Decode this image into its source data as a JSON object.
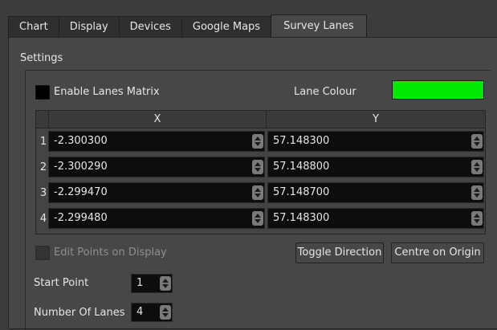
{
  "tabs": [
    "Chart",
    "Display",
    "Devices",
    "Google Maps",
    "Survey Lanes"
  ],
  "group_title": "Settings",
  "enable_lanes_label": "Enable Lanes Matrix",
  "lane_colour_label": "Lane Colour",
  "lane_colour": "#00e800",
  "table": {
    "headers": [
      "X",
      "Y"
    ],
    "rows": [
      {
        "num": "1",
        "x": "-2.300300",
        "y": "57.148300"
      },
      {
        "num": "2",
        "x": "-2.300290",
        "y": "57.148800"
      },
      {
        "num": "3",
        "x": "-2.299470",
        "y": "57.148700"
      },
      {
        "num": "4",
        "x": "-2.299480",
        "y": "57.148300"
      }
    ]
  },
  "edit_points_label": "Edit Points on Display",
  "toggle_direction_label": "Toggle Direction",
  "centre_on_origin_label": "Centre on Origin",
  "start_point_label": "Start Point",
  "start_point_value": "1",
  "number_of_lanes_label": "Number Of Lanes",
  "number_of_lanes_value": "4"
}
